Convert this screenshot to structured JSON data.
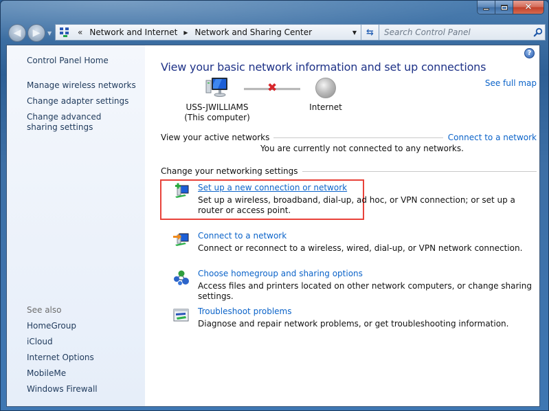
{
  "window": {
    "caption": {
      "minimize": "minimize",
      "maximize": "maximize",
      "close": "✕"
    }
  },
  "nav": {
    "back_icon": "◀",
    "forward_icon": "▶",
    "history_dropdown": "▼",
    "address": {
      "chevron": "«",
      "breadcrumbs": [
        "Network and Internet",
        "Network and Sharing Center"
      ],
      "separator": "▶",
      "dropdown": "▼"
    },
    "refresh_icon": "⇆",
    "search": {
      "placeholder": "Search Control Panel",
      "value": ""
    }
  },
  "sidebar": {
    "home": "Control Panel Home",
    "tasks": [
      "Manage wireless networks",
      "Change adapter settings",
      "Change advanced sharing settings"
    ],
    "see_also_label": "See also",
    "see_also": [
      "HomeGroup",
      "iCloud",
      "Internet Options",
      "MobileMe",
      "Windows Firewall"
    ]
  },
  "main": {
    "help_icon": "?",
    "title": "View your basic network information and set up connections",
    "see_full_map": "See full map",
    "network_map": {
      "computer_name": "USS-JWILLIAMS",
      "computer_sub": "(This computer)",
      "link_status": "disconnected",
      "link_status_glyph": "✖",
      "internet_label": "Internet"
    },
    "active_networks": {
      "heading": "View your active networks",
      "action": "Connect to a network",
      "status": "You are currently not connected to any networks."
    },
    "settings": {
      "heading": "Change your networking settings",
      "tasks": [
        {
          "title": "Set up a new connection or network",
          "desc": "Set up a wireless, broadband, dial-up, ad hoc, or VPN connection; or set up a router or access point.",
          "highlighted": true
        },
        {
          "title": "Connect to a network",
          "desc": "Connect or reconnect to a wireless, wired, dial-up, or VPN network connection.",
          "highlighted": false
        },
        {
          "title": "Choose homegroup and sharing options",
          "desc": "Access files and printers located on other network computers, or change sharing settings.",
          "highlighted": false
        },
        {
          "title": "Troubleshoot problems",
          "desc": "Diagnose and repair network problems, or get troubleshooting information.",
          "highlighted": false
        }
      ]
    },
    "highlight_color": "#e8423a",
    "link_color": "#0b63c9",
    "title_color": "#1e3287"
  }
}
